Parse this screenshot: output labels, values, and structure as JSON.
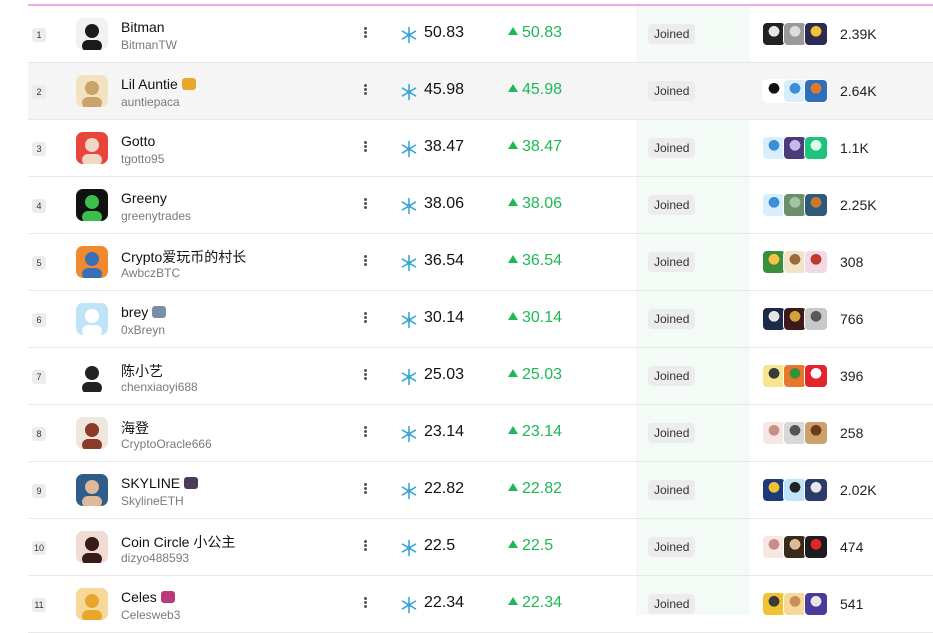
{
  "joined_label": "Joined",
  "rows": [
    {
      "rank": "1",
      "name": "Bitman",
      "handle": "BitmanTW",
      "score": "50.83",
      "change": "50.83",
      "followers": "2.39K",
      "avatar_colors": [
        "#f2f2f2",
        "#1a1a1a"
      ],
      "emoji": null,
      "highlighted": false,
      "mini_colors": [
        [
          "#222222",
          "#e6e6e6"
        ],
        [
          "#9a9a9a",
          "#dddddd"
        ],
        [
          "#2b2b55",
          "#f1c232"
        ]
      ]
    },
    {
      "rank": "2",
      "name": "Lil Auntie",
      "handle": "auntiepaca",
      "score": "45.98",
      "change": "45.98",
      "followers": "2.64K",
      "avatar_colors": [
        "#f3e2bf",
        "#c9a36a"
      ],
      "emoji": "#e8a62a",
      "highlighted": true,
      "mini_colors": [
        [
          "#ffffff",
          "#111111"
        ],
        [
          "#d9eefa",
          "#3a8fd6"
        ],
        [
          "#2d6fb8",
          "#e8772e"
        ]
      ]
    },
    {
      "rank": "3",
      "name": "Gotto",
      "handle": "tgotto95",
      "score": "38.47",
      "change": "38.47",
      "followers": "1.1K",
      "avatar_colors": [
        "#e8463c",
        "#f4d6c7"
      ],
      "emoji": null,
      "highlighted": false,
      "mini_colors": [
        [
          "#d9eefa",
          "#3a8fd6"
        ],
        [
          "#4a3b7a",
          "#c9b8e8"
        ],
        [
          "#1ec27a",
          "#d7ffe9"
        ]
      ]
    },
    {
      "rank": "4",
      "name": "Greeny",
      "handle": "greenytrades",
      "score": "38.06",
      "change": "38.06",
      "followers": "2.25K",
      "avatar_colors": [
        "#111111",
        "#3bbf4a"
      ],
      "emoji": null,
      "highlighted": false,
      "mini_colors": [
        [
          "#d9eefa",
          "#3a8fd6"
        ],
        [
          "#6b8f6b",
          "#a3c4a3"
        ],
        [
          "#2d5a7a",
          "#c47a2e"
        ]
      ]
    },
    {
      "rank": "5",
      "name": "Crypto爱玩币的村长",
      "handle": "AwbczBTC",
      "score": "36.54",
      "change": "36.54",
      "followers": "308",
      "avatar_colors": [
        "#f08a2c",
        "#3a6fb8"
      ],
      "emoji": null,
      "highlighted": false,
      "mini_colors": [
        [
          "#3a8f3a",
          "#f6c343"
        ],
        [
          "#f1e3c8",
          "#9b6a3c"
        ],
        [
          "#f3d8e6",
          "#c0392b"
        ]
      ]
    },
    {
      "rank": "6",
      "name": "brey",
      "handle": "0xBreyn",
      "score": "30.14",
      "change": "30.14",
      "followers": "766",
      "avatar_colors": [
        "#bfe4f7",
        "#ffffff"
      ],
      "emoji": "#7a8fa6",
      "highlighted": false,
      "mini_colors": [
        [
          "#1d2b4a",
          "#e6e6e6"
        ],
        [
          "#3a1a1a",
          "#d4a23a"
        ],
        [
          "#c8c8c8",
          "#5a5a5a"
        ]
      ]
    },
    {
      "rank": "7",
      "name": "陈小艺",
      "handle": "chenxiaoyi688",
      "score": "25.03",
      "change": "25.03",
      "followers": "396",
      "avatar_colors": [
        "#ffffff",
        "#222222"
      ],
      "emoji": null,
      "highlighted": false,
      "mini_colors": [
        [
          "#f6e58d",
          "#3a3a3a"
        ],
        [
          "#e8772e",
          "#3a8f3a"
        ],
        [
          "#e3242b",
          "#ffffff"
        ]
      ]
    },
    {
      "rank": "8",
      "name": "海登",
      "handle": "CryptoOracle666",
      "score": "23.14",
      "change": "23.14",
      "followers": "258",
      "avatar_colors": [
        "#efe6dd",
        "#8a3b2a"
      ],
      "emoji": null,
      "highlighted": false,
      "mini_colors": [
        [
          "#f7e7e4",
          "#c98f86"
        ],
        [
          "#d8d8d8",
          "#555555"
        ],
        [
          "#c9a36a",
          "#6b3b1a"
        ]
      ]
    },
    {
      "rank": "9",
      "name": "SKYLINE",
      "handle": "SkylineETH",
      "score": "22.82",
      "change": "22.82",
      "followers": "2.02K",
      "avatar_colors": [
        "#2f5d8a",
        "#e0b89a"
      ],
      "emoji": "#4a3b5a",
      "highlighted": false,
      "mini_colors": [
        [
          "#1d3b7a",
          "#f1c232"
        ],
        [
          "#bfe4f7",
          "#222222"
        ],
        [
          "#2a3a6a",
          "#e6e6e6"
        ]
      ]
    },
    {
      "rank": "10",
      "name": "Coin Circle 小公主",
      "handle": "dizyo488593",
      "score": "22.5",
      "change": "22.5",
      "followers": "474",
      "avatar_colors": [
        "#f0dcd4",
        "#3a1a1a"
      ],
      "emoji": null,
      "highlighted": false,
      "mini_colors": [
        [
          "#f7e7e4",
          "#c98f86"
        ],
        [
          "#3a2a1a",
          "#e0b89a"
        ],
        [
          "#1d1d1d",
          "#e3242b"
        ]
      ]
    },
    {
      "rank": "11",
      "name": "Celes",
      "handle": "Celesweb3",
      "score": "22.34",
      "change": "22.34",
      "followers": "541",
      "avatar_colors": [
        "#f6d89a",
        "#e8a62a"
      ],
      "emoji": "#b83a7a",
      "highlighted": false,
      "mini_colors": [
        [
          "#f1c232",
          "#3a3a3a"
        ],
        [
          "#f6d89a",
          "#c98f5a"
        ],
        [
          "#4a3b9a",
          "#e6e6e6"
        ]
      ]
    }
  ]
}
